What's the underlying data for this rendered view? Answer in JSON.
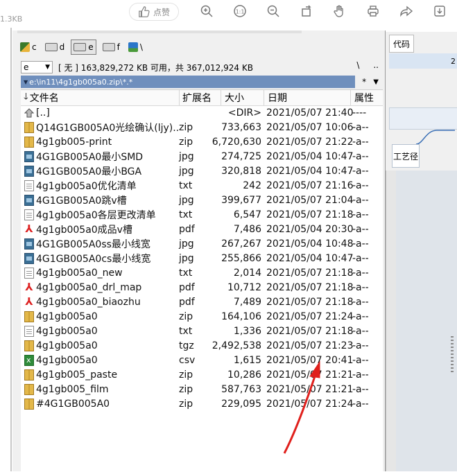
{
  "viewer_toolbar": {
    "filesize_hint": "1.3KB",
    "like_label": "点赞",
    "icons": [
      "thumbs-up-icon",
      "zoom-in-icon",
      "actual-size-icon",
      "zoom-out-icon",
      "rotate-icon",
      "hand-icon",
      "print-icon",
      "share-icon",
      "download-icon"
    ]
  },
  "right_panel": {
    "header": "代码",
    "digit": "2",
    "tab_label": "工艺径"
  },
  "drives": [
    {
      "label": "c",
      "type": "sys"
    },
    {
      "label": "d",
      "type": "disk"
    },
    {
      "label": "e",
      "type": "disk",
      "selected": true
    },
    {
      "label": "f",
      "type": "disk"
    },
    {
      "label": "\\",
      "type": "net"
    }
  ],
  "infobar": {
    "drive_value": "e",
    "info": "[ 无 ]  163,829,272 KB 可用，共 367,012,924 KB",
    "nav_root": "\\",
    "nav_up": ".."
  },
  "path": {
    "text": "e:\\in11\\4g1gb005a0.zip\\*.*",
    "filter": "*",
    "dropdown": "▼"
  },
  "columns": {
    "name": "文件名",
    "ext": "扩展名",
    "size": "大小",
    "date": "日期",
    "attr": "属性"
  },
  "files": [
    {
      "icon": "up",
      "name": "[..]",
      "ext": "",
      "size": "<DIR>",
      "date": "2021/05/07 21:40",
      "attr": "----"
    },
    {
      "icon": "zip",
      "name": "Q14G1GB005A0光绘确认(ljy)..",
      "ext": "zip",
      "size": "733,663",
      "date": "2021/05/07 10:06",
      "attr": "-a--"
    },
    {
      "icon": "zip",
      "name": "4g1gb005-print",
      "ext": "zip",
      "size": "6,720,630",
      "date": "2021/05/07 21:22",
      "attr": "-a--"
    },
    {
      "icon": "img",
      "name": "4G1GB005A0最小SMD",
      "ext": "jpg",
      "size": "274,725",
      "date": "2021/05/04 10:47",
      "attr": "-a--"
    },
    {
      "icon": "img",
      "name": "4G1GB005A0最小BGA",
      "ext": "jpg",
      "size": "320,818",
      "date": "2021/05/04 10:47",
      "attr": "-a--"
    },
    {
      "icon": "txt",
      "name": "4g1gb005a0优化清单",
      "ext": "txt",
      "size": "242",
      "date": "2021/05/07 21:16",
      "attr": "-a--"
    },
    {
      "icon": "img",
      "name": "4G1GB005A0跳v槽",
      "ext": "jpg",
      "size": "399,677",
      "date": "2021/05/07 21:04",
      "attr": "-a--"
    },
    {
      "icon": "txt",
      "name": "4g1gb005a0各层更改清单",
      "ext": "txt",
      "size": "6,547",
      "date": "2021/05/07 21:18",
      "attr": "-a--"
    },
    {
      "icon": "pdf",
      "name": "4g1gb005a0成品v槽",
      "ext": "pdf",
      "size": "7,486",
      "date": "2021/05/04 20:30",
      "attr": "-a--"
    },
    {
      "icon": "img",
      "name": "4G1GB005A0ss最小线宽",
      "ext": "jpg",
      "size": "267,267",
      "date": "2021/05/04 10:48",
      "attr": "-a--"
    },
    {
      "icon": "img",
      "name": "4G1GB005A0cs最小线宽",
      "ext": "jpg",
      "size": "255,866",
      "date": "2021/05/04 10:47",
      "attr": "-a--"
    },
    {
      "icon": "txt",
      "name": "4g1gb005a0_new",
      "ext": "txt",
      "size": "2,014",
      "date": "2021/05/07 21:18",
      "attr": "-a--"
    },
    {
      "icon": "pdf",
      "name": "4g1gb005a0_drl_map",
      "ext": "pdf",
      "size": "10,712",
      "date": "2021/05/07 21:18",
      "attr": "-a--"
    },
    {
      "icon": "pdf",
      "name": "4g1gb005a0_biaozhu",
      "ext": "pdf",
      "size": "7,489",
      "date": "2021/05/07 21:18",
      "attr": "-a--"
    },
    {
      "icon": "zip",
      "name": "4g1gb005a0",
      "ext": "zip",
      "size": "164,106",
      "date": "2021/05/07 21:24",
      "attr": "-a--"
    },
    {
      "icon": "txt",
      "name": "4g1gb005a0",
      "ext": "txt",
      "size": "1,336",
      "date": "2021/05/07 21:18",
      "attr": "-a--"
    },
    {
      "icon": "zip",
      "name": "4g1gb005a0",
      "ext": "tgz",
      "size": "2,492,538",
      "date": "2021/05/07 21:23",
      "attr": "-a--"
    },
    {
      "icon": "csv",
      "name": "4g1gb005a0",
      "ext": "csv",
      "size": "1,615",
      "date": "2021/05/07 20:41",
      "attr": "-a--"
    },
    {
      "icon": "zip",
      "name": "4g1gb005_paste",
      "ext": "zip",
      "size": "10,286",
      "date": "2021/05/07 21:21",
      "attr": "-a--"
    },
    {
      "icon": "zip",
      "name": "4g1gb005_film",
      "ext": "zip",
      "size": "587,763",
      "date": "2021/05/07 21:21",
      "attr": "-a--"
    },
    {
      "icon": "zip",
      "name": "#4G1GB005A0",
      "ext": "zip",
      "size": "229,095",
      "date": "2021/05/07 21:24",
      "attr": "-a--"
    }
  ],
  "annotation": {
    "color": "#e0201c"
  }
}
